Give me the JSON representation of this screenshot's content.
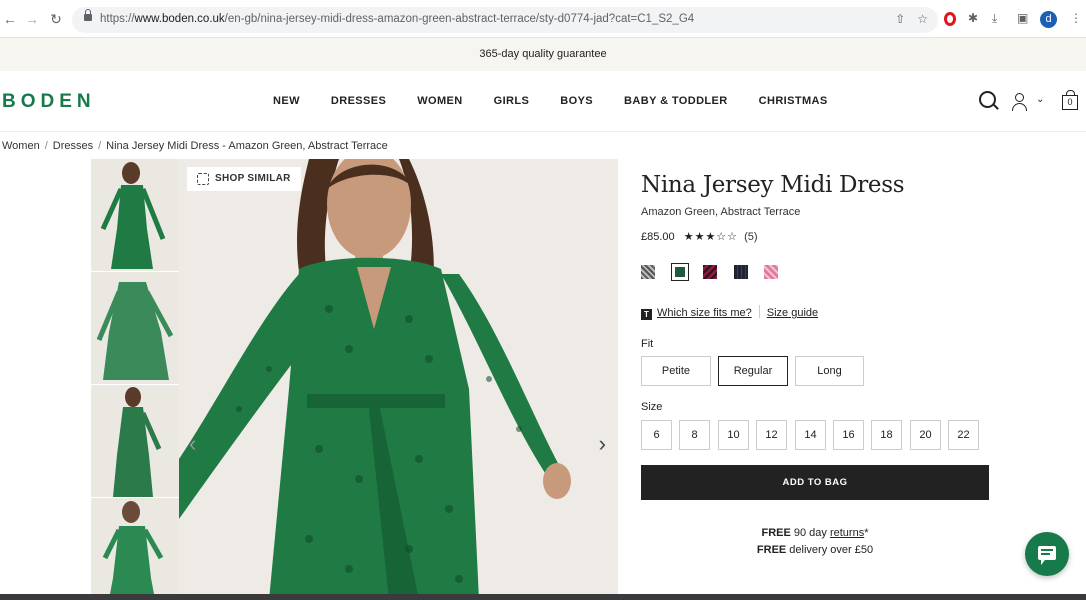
{
  "browser": {
    "url_prefix": "https://",
    "url_host": "www.boden.co.uk",
    "url_path": "/en-gb/nina-jersey-midi-dress-amazon-green-abstract-terrace/sty-d0774-jad?cat=C1_S2_G4",
    "profile_initial": "d"
  },
  "promo": {
    "text": "365-day quality guarantee"
  },
  "header": {
    "logo": "BODEN",
    "nav": [
      "NEW",
      "DRESSES",
      "WOMEN",
      "GIRLS",
      "BOYS",
      "BABY & TODDLER",
      "CHRISTMAS"
    ],
    "bag_count": "0"
  },
  "breadcrumb": [
    "Women",
    "Dresses",
    "Nina Jersey Midi Dress - Amazon Green, Abstract Terrace"
  ],
  "gallery": {
    "shop_similar": "SHOP SIMILAR"
  },
  "product": {
    "title": "Nina Jersey Midi Dress",
    "color_name": "Amazon Green, Abstract Terrace",
    "price": "£85.00",
    "rating": 3,
    "rating_max": 5,
    "stars_text": "★★★☆☆",
    "review_count": "(5)",
    "swatch_colors": [
      "#8a8a8a",
      "#1e5a3c",
      "#8c1b3a",
      "#1e2233",
      "#e07a9a"
    ],
    "which_size": "Which size fits me?",
    "size_guide": "Size guide",
    "fit_label": "Fit",
    "fits": [
      "Petite",
      "Regular",
      "Long"
    ],
    "fit_selected": "Regular",
    "size_label": "Size",
    "sizes": [
      "6",
      "8",
      "10",
      "12",
      "14",
      "16",
      "18",
      "20",
      "22"
    ],
    "add_to_bag": "ADD TO BAG",
    "delivery": {
      "line1_bold": "FREE",
      "line1_text": " 90 day ",
      "line1_link": "returns",
      "line1_suffix": "*",
      "line2_bold": "FREE",
      "line2_text": " delivery over £50"
    }
  },
  "colors": {
    "brand": "#167a4a",
    "dress": "#1f7a43"
  }
}
